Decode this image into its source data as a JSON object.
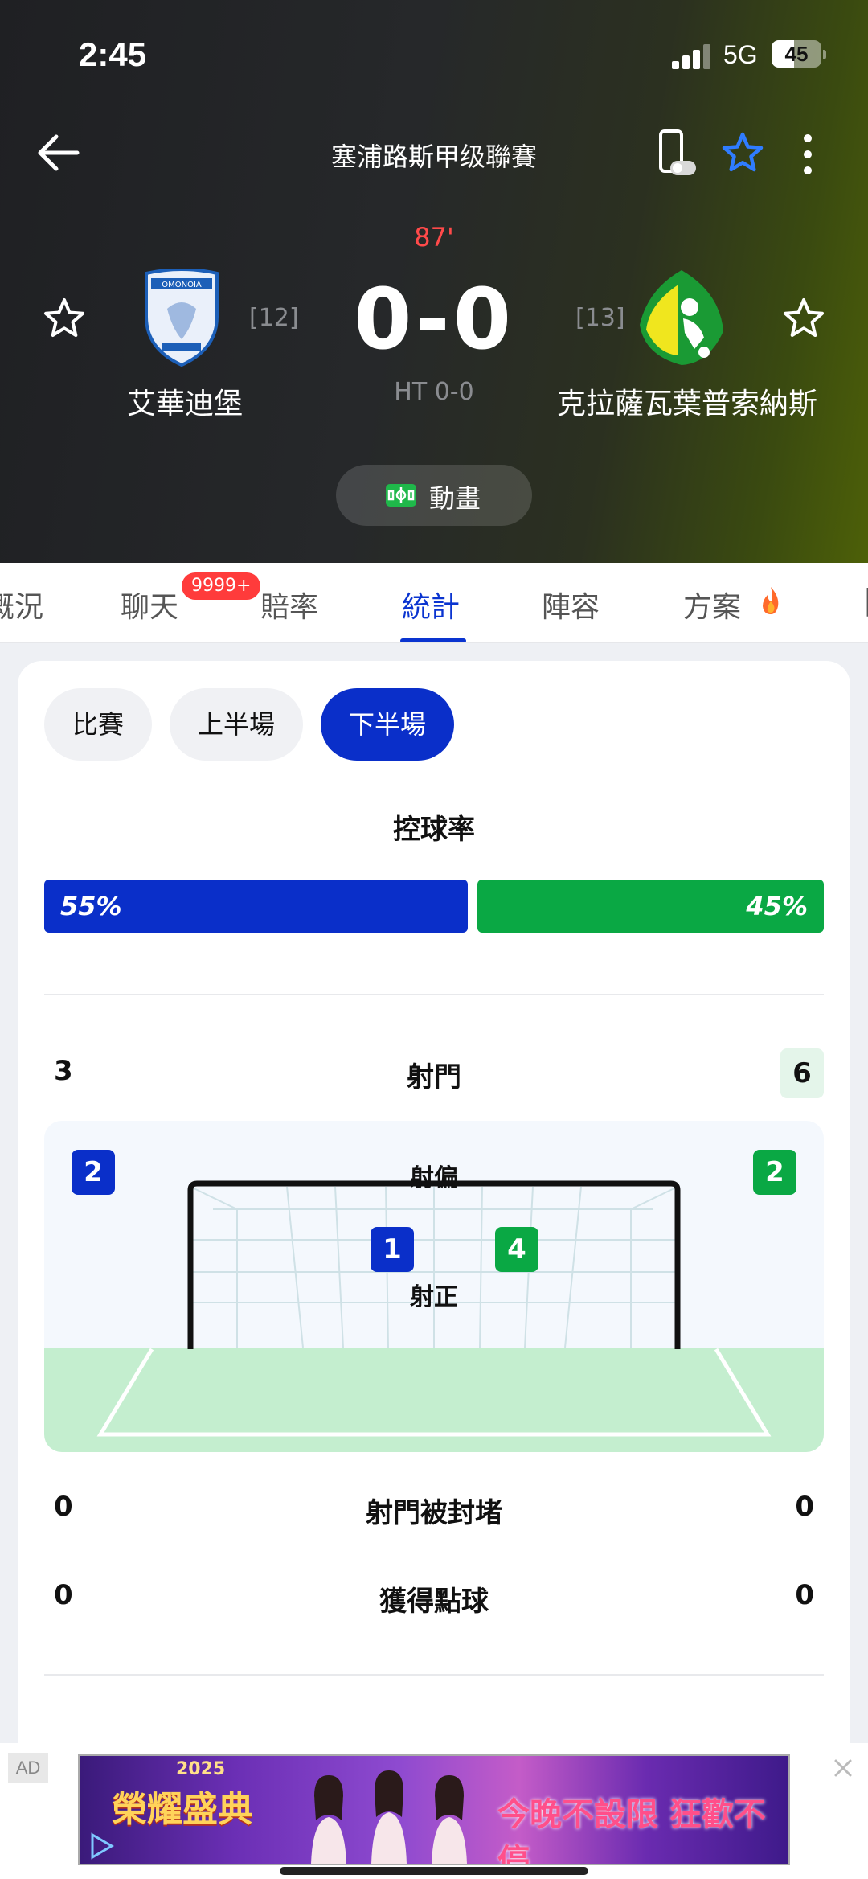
{
  "status_bar": {
    "time": "2:45",
    "network": "5G",
    "battery": "45",
    "battery_level": 0.45
  },
  "nav": {
    "league": "塞浦路斯甲级聯賽"
  },
  "match": {
    "minute": "87'",
    "home": {
      "name": "艾華迪堡",
      "rank": "[12]",
      "crest_text": "OMONOIA"
    },
    "away": {
      "name": "克拉薩瓦葉普索納斯",
      "rank": "[13]"
    },
    "score": "0-0",
    "halftime": "HT 0-0",
    "animation_label": "動畫"
  },
  "tabs": [
    {
      "label": "概況"
    },
    {
      "label": "聊天",
      "badge": "9999+"
    },
    {
      "label": "賠率"
    },
    {
      "label": "統計",
      "active": true
    },
    {
      "label": "陣容"
    },
    {
      "label": "方案"
    }
  ],
  "periods": [
    {
      "label": "比賽"
    },
    {
      "label": "上半場"
    },
    {
      "label": "下半場",
      "active": true
    }
  ],
  "possession": {
    "title": "控球率",
    "home": "55%",
    "away": "45%",
    "home_value": 55,
    "away_value": 45
  },
  "stats": {
    "shots": {
      "label": "射門",
      "home": "3",
      "away": "6"
    },
    "off_target": {
      "label": "射偏",
      "home": "2",
      "away": "2"
    },
    "on_target": {
      "label": "射正",
      "home": "1",
      "away": "4"
    },
    "blocked": {
      "label": "射門被封堵",
      "home": "0",
      "away": "0"
    },
    "penalties": {
      "label": "獲得點球",
      "home": "0",
      "away": "0"
    }
  },
  "ad": {
    "tag": "AD",
    "left_text": "榮耀盛典",
    "year": "2025",
    "right_text": "今晚不設限 狂歡不停"
  },
  "colors": {
    "home": "#0a2fc9",
    "away": "#0aa844",
    "accent": "#0a34d0",
    "minute": "#ff4a4a"
  }
}
